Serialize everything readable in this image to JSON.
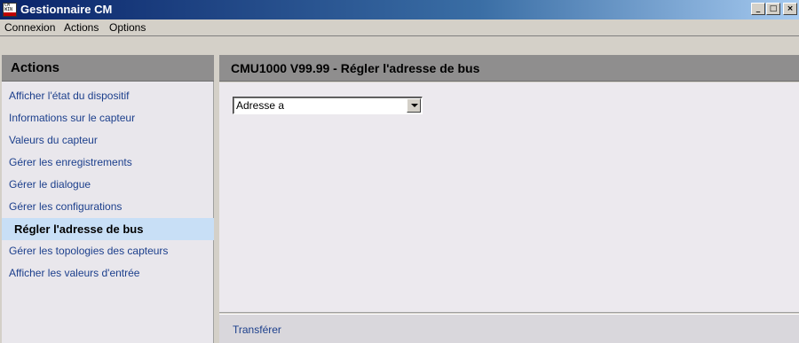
{
  "window": {
    "title": "Gestionnaire CM",
    "icon_text": "CM WIN",
    "minimize_label": "_",
    "maximize_label": "□",
    "close_label": "×"
  },
  "menubar": {
    "items": [
      "Connexion",
      "Actions",
      "Options"
    ]
  },
  "sidebar": {
    "header": "Actions",
    "items": [
      {
        "label": "Afficher l'état du dispositif",
        "active": false
      },
      {
        "label": "Informations sur le capteur",
        "active": false
      },
      {
        "label": "Valeurs du capteur",
        "active": false
      },
      {
        "label": "Gérer les enregistrements",
        "active": false
      },
      {
        "label": "Gérer le dialogue",
        "active": false
      },
      {
        "label": "Gérer les configurations",
        "active": false
      },
      {
        "label": "Régler l'adresse de bus",
        "active": true
      },
      {
        "label": "Gérer les topologies des capteurs",
        "active": false
      },
      {
        "label": "Afficher les valeurs d'entrée",
        "active": false
      }
    ]
  },
  "main": {
    "title": "CMU1000 V99.99 - Régler l'adresse de bus",
    "address_select": {
      "selected": "Adresse a"
    },
    "footer": {
      "transfer_label": "Transférer"
    }
  },
  "colors": {
    "titlebar_start": "#0a246a",
    "panel_header": "#8f8e8e",
    "sidebar_link": "#1c3f8c",
    "active_item_bg": "#c8dff6"
  }
}
